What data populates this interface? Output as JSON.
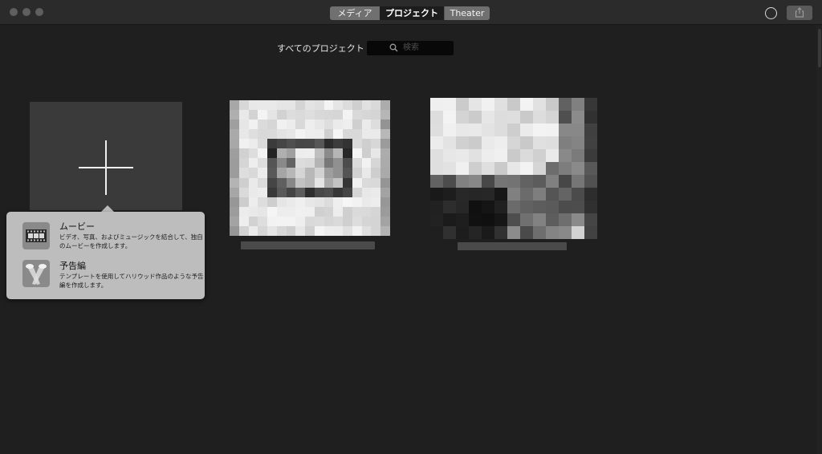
{
  "toolbar": {
    "tabs": [
      {
        "label": "メディア",
        "selected": false
      },
      {
        "label": "プロジェクト",
        "selected": true
      },
      {
        "label": "Theater",
        "selected": false
      }
    ]
  },
  "filter": {
    "label": "すべてのプロジェクト",
    "chevron": "⌃⌄"
  },
  "search": {
    "placeholder": "検索"
  },
  "popover": {
    "options": [
      {
        "title": "ムービー",
        "description": "ビデオ、写真、およびミュージックを結合して、独自のムービーを作成します。",
        "icon": "film-strip-icon"
      },
      {
        "title": "予告編",
        "description": "テンプレートを使用してハリウッド作品のような予告編を作成します。",
        "icon": "trailer-spotlight-icon"
      }
    ]
  },
  "projects": [
    {
      "title_visible": false,
      "thumbnail": "pixelated-image"
    },
    {
      "title_visible": false,
      "thumbnail": "pixelated-image"
    }
  ],
  "colors": {
    "background": "#1f1f1f",
    "titlebar": "#2b2b2b",
    "popover": "#bdbdbd",
    "selected_tab": "#1c1c1c",
    "tab": "#707070"
  }
}
